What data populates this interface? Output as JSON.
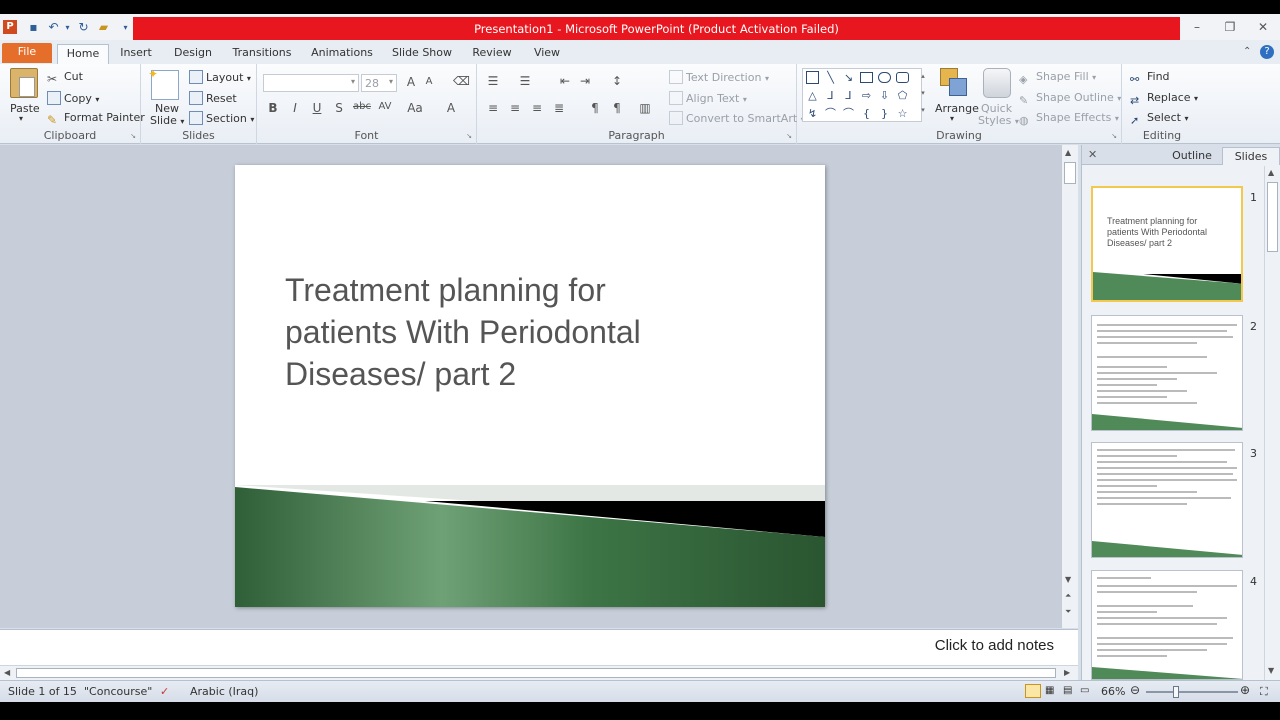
{
  "window": {
    "title": "Presentation1  -  Microsoft PowerPoint (Product Activation Failed)",
    "controls": [
      "minimize",
      "restore",
      "close"
    ]
  },
  "tabs": [
    "File",
    "Home",
    "Insert",
    "Design",
    "Transitions",
    "Animations",
    "Slide Show",
    "Review",
    "View"
  ],
  "ribbon": {
    "clipboard": {
      "label": "Clipboard",
      "paste": "Paste",
      "cut": "Cut",
      "copy": "Copy",
      "format_painter": "Format Painter"
    },
    "slides": {
      "label": "Slides",
      "new_slide_line1": "New",
      "new_slide_line2": "Slide",
      "layout": "Layout",
      "reset": "Reset",
      "section": "Section"
    },
    "font": {
      "label": "Font",
      "font_name": "",
      "font_size": "28"
    },
    "paragraph": {
      "label": "Paragraph",
      "text_direction": "Text Direction",
      "align_text": "Align Text",
      "convert_smartart": "Convert to SmartArt"
    },
    "drawing": {
      "label": "Drawing",
      "arrange": "Arrange",
      "quick_styles_line1": "Quick",
      "quick_styles_line2": "Styles",
      "shape_fill": "Shape Fill",
      "shape_outline": "Shape Outline",
      "shape_effects": "Shape Effects"
    },
    "editing": {
      "label": "Editing",
      "find": "Find",
      "replace": "Replace",
      "select": "Select"
    }
  },
  "slide": {
    "title": " Treatment planning for\npatients With Periodontal\nDiseases/ part 2"
  },
  "notes": {
    "placeholder": "Click to add notes"
  },
  "pane": {
    "close": "✕",
    "tab_outline": "Outline",
    "tab_slides": "Slides",
    "thumbnails": [
      {
        "number": "1",
        "text": "Treatment planning for patients With Periodontal Diseases/ part 2"
      },
      {
        "number": "2",
        "text": ""
      },
      {
        "number": "3",
        "text": ""
      },
      {
        "number": "4",
        "text": ""
      }
    ]
  },
  "status": {
    "slide_info": "Slide 1 of 15",
    "theme": "\"Concourse\"",
    "language": "Arabic (Iraq)",
    "zoom": "66%",
    "zoom_level_fraction": 0.33
  },
  "colors": {
    "title_bar": "#e8161e",
    "file_tab": "#e56e2a",
    "slide_green": "#3f7a4a",
    "selected_thumb": "#f2c94c"
  }
}
